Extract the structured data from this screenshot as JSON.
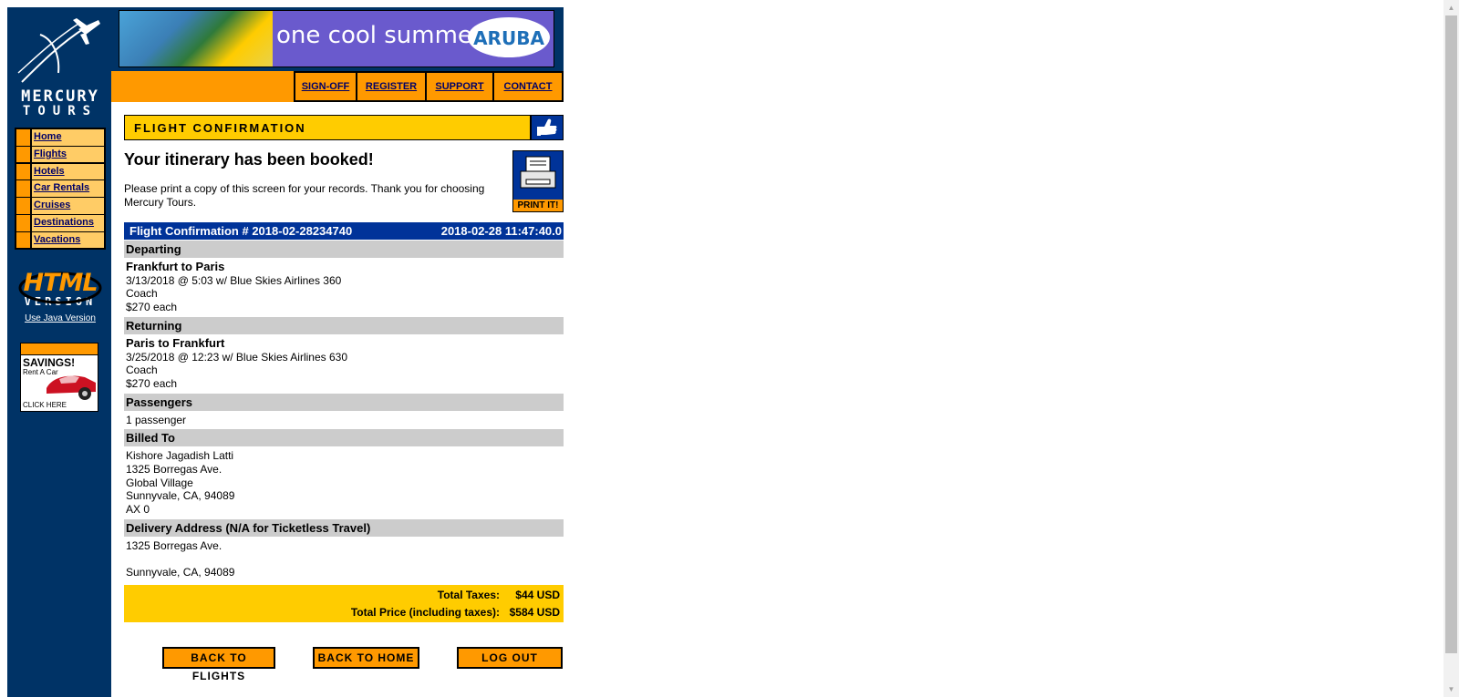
{
  "brand": {
    "name_line1": "MERCURY",
    "name_line2": "TOURS"
  },
  "sidebar": {
    "nav": [
      {
        "label": "Home"
      },
      {
        "label": "Flights"
      },
      {
        "label": "Hotels"
      },
      {
        "label": "Car Rentals"
      },
      {
        "label": "Cruises"
      },
      {
        "label": "Destinations"
      },
      {
        "label": "Vacations"
      }
    ],
    "html_version": {
      "big": "HTML",
      "small": "VERSION",
      "java_link": "Use Java Version"
    },
    "ad": {
      "title": "SAVINGS!",
      "sub": "Rent A Car",
      "cta": "CLICK HERE"
    }
  },
  "banner": {
    "tagline": "one cool summer",
    "logo": "ARUBA"
  },
  "topnav": [
    {
      "label": "SIGN-OFF"
    },
    {
      "label": "REGISTER"
    },
    {
      "label": "SUPPORT"
    },
    {
      "label": "CONTACT"
    }
  ],
  "page": {
    "section_title": "FLIGHT CONFIRMATION",
    "heading": "Your itinerary has been booked!",
    "message": "Please print a copy of this screen for your records. Thank you for choosing Mercury Tours.",
    "print_label": "PRINT IT!"
  },
  "confirmation": {
    "number_label": "Flight Confirmation # 2018-02-28234740",
    "timestamp": "2018-02-28 11:47:40.0",
    "departing": {
      "header": "Departing",
      "route": "Frankfurt to Paris",
      "detail": "3/13/2018 @ 5:03 w/ Blue Skies Airlines 360",
      "class": "Coach",
      "price": "$270 each"
    },
    "returning": {
      "header": "Returning",
      "route": "Paris to Frankfurt",
      "detail": "3/25/2018 @ 12:23 w/ Blue Skies Airlines 630",
      "class": "Coach",
      "price": "$270 each"
    },
    "passengers": {
      "header": "Passengers",
      "value": "1 passenger"
    },
    "billed_to": {
      "header": "Billed To",
      "name": "Kishore Jagadish Latti",
      "address1": "1325 Borregas Ave.",
      "address2": "Global Village",
      "city_line": "Sunnyvale, CA, 94089",
      "card": "AX 0"
    },
    "delivery": {
      "header": "Delivery Address (N/A for Ticketless Travel)",
      "address1": "1325 Borregas Ave.",
      "address2": "",
      "city_line": "Sunnyvale, CA, 94089"
    },
    "totals": {
      "taxes_label": "Total Taxes:",
      "taxes_value": "$44 USD",
      "price_label": "Total Price (including taxes):",
      "price_value": "$584 USD"
    }
  },
  "buttons": {
    "back_flights": "BACK TO FLIGHTS",
    "back_home": "BACK TO HOME",
    "logout": "LOG OUT"
  },
  "colors": {
    "sidebar_bg": "#003366",
    "accent_orange": "#ff9900",
    "accent_yellow": "#ffcc00",
    "header_blue": "#003399",
    "section_gray": "#cccccc"
  }
}
